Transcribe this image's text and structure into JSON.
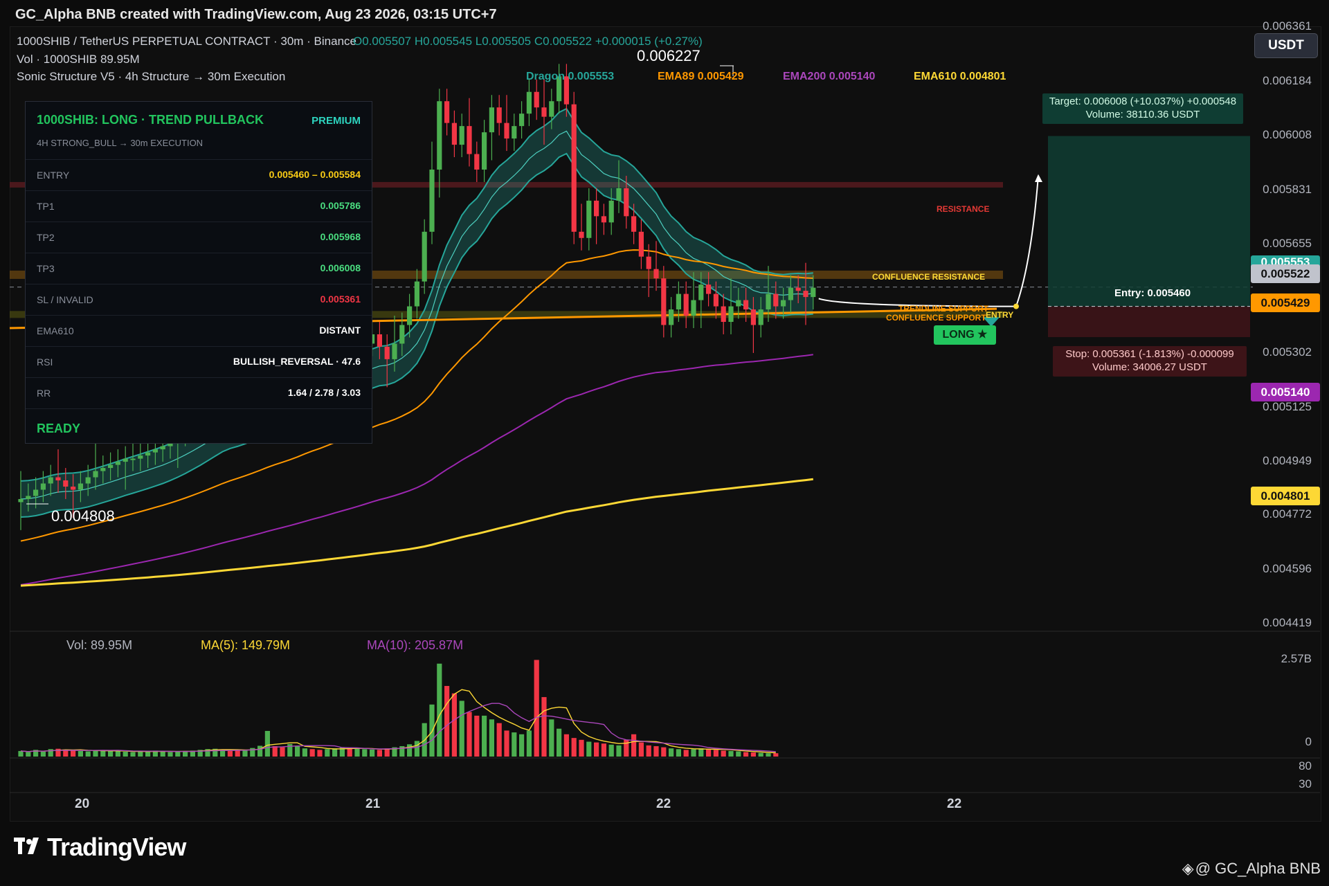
{
  "header": {
    "title": "GC_Alpha BNB created with TradingView.com, Aug 23 2026, 03:15 UTC+7"
  },
  "legend": {
    "symbol": "1000SHIB / TetherUS PERPETUAL CONTRACT · 30m · Binance",
    "ohlc": "O0.005507 H0.005545 L0.005505 C0.005522 +0.000015 (+0.27%)",
    "volume": "Vol · 1000SHIB  89.95M",
    "indicator": "Sonic Structure V5 · 4h Structure → 30m Execution"
  },
  "ema_labels": {
    "dragon": "Dragon 0.005553",
    "ema89": "EMA89 0.005429",
    "ema200": "EMA200 0.005140",
    "ema610": "EMA610 0.004801"
  },
  "colors": {
    "up": "#4caf50",
    "down": "#f23645",
    "dragon": "#26a69a",
    "ema89": "#ff9800",
    "ema200": "#9c27b0",
    "ema610": "#fdd835",
    "target_zone": "#0f3d33",
    "stop_zone": "#3d1418"
  },
  "signal_card": {
    "title": "1000SHIB: LONG · TREND PULLBACK",
    "badge": "PREMIUM",
    "subtitle": "4H STRONG_BULL → 30m EXECUTION",
    "rows": [
      {
        "key": "ENTRY",
        "value": "0.005460 – 0.005584"
      },
      {
        "key": "TP1",
        "value": "0.005786"
      },
      {
        "key": "TP2",
        "value": "0.005968"
      },
      {
        "key": "TP3",
        "value": "0.006008"
      },
      {
        "key": "SL / INVALID",
        "value": "0.005361"
      },
      {
        "key": "EMA610",
        "value": "DISTANT"
      },
      {
        "key": "RSI",
        "value": "BULLISH_REVERSAL · 47.6"
      },
      {
        "key": "RR",
        "value": "1.64 / 2.78 / 3.03"
      }
    ],
    "status": "READY"
  },
  "price_axis": {
    "ticks": [
      "0.006361",
      "0.006184",
      "0.006008",
      "0.005831",
      "0.005655",
      "0.005302",
      "0.005125",
      "0.004949",
      "0.004772",
      "0.004596",
      "0.004419"
    ],
    "currency_button": "USDT",
    "tags": {
      "dragon": "0.005553",
      "last": "0.005522",
      "ema89": "0.005429",
      "ema200": "0.005140",
      "ema610": "0.004801"
    }
  },
  "chart_annotations": {
    "high": "0.006227",
    "low": "0.004808",
    "resistance": "RESISTANCE",
    "confluence_resistance": "CONFLUENCE RESISTANCE",
    "trendline_support": "TRENDLINE SUPPORT",
    "confluence_support": "CONFLUENCE SUPPORT",
    "entry_marker": "ENTRY",
    "long_badge": "LONG ★",
    "entry": "Entry: 0.005460",
    "target_line1": "Target: 0.006008  (+10.037%)  +0.000548",
    "target_line2": "Volume: 38110.36 USDT",
    "stop_line1": "Stop: 0.005361  (-1.813%)  -0.000099",
    "stop_line2": "Volume: 34006.27 USDT"
  },
  "volume_pane": {
    "vol": "Vol: 89.95M",
    "ma5": "MA(5): 149.79M",
    "ma10": "MA(10): 205.87M",
    "axis_top": "2.57B",
    "axis_zero": "0"
  },
  "rsi_axis": {
    "top": "80",
    "bottom": "30"
  },
  "time_axis": [
    "20",
    "21",
    "22",
    "22"
  ],
  "footer": {
    "logo": "TradingView",
    "watermark": "@ GC_Alpha BNB"
  },
  "chart_data": {
    "type": "candlestick",
    "symbol": "1000SHIB/USDT",
    "timeframe": "30m",
    "y_range": [
      0.004419,
      0.006361
    ],
    "last_close": 0.005522,
    "high_marker": 0.006227,
    "low_marker": 0.004808,
    "indicators": [
      {
        "name": "Dragon",
        "last": 0.005553
      },
      {
        "name": "EMA89",
        "last": 0.005429
      },
      {
        "name": "EMA200",
        "last": 0.00514
      },
      {
        "name": "EMA610",
        "last": 0.004801
      }
    ],
    "closes": [
      0.00484,
      0.00485,
      0.00487,
      0.00489,
      0.00491,
      0.0049,
      0.00488,
      0.00487,
      0.00489,
      0.00491,
      0.00493,
      0.00494,
      0.00495,
      0.00496,
      0.00497,
      0.00497,
      0.00498,
      0.00499,
      0.005,
      0.00501,
      0.00503,
      0.00505,
      0.00507,
      0.00509,
      0.00511,
      0.00513,
      0.00515,
      0.00516,
      0.00514,
      0.00512,
      0.00514,
      0.00516,
      0.00518,
      0.00521,
      0.00519,
      0.00517,
      0.00519,
      0.00522,
      0.00526,
      0.00525,
      0.00523,
      0.00527,
      0.00529,
      0.0053,
      0.00527,
      0.00532,
      0.00534,
      0.00537,
      0.00533,
      0.00529,
      0.00534,
      0.0054,
      0.00546,
      0.00554,
      0.0057,
      0.0059,
      0.00612,
      0.00605,
      0.00598,
      0.00604,
      0.00595,
      0.0059,
      0.00602,
      0.0061,
      0.00605,
      0.006,
      0.00604,
      0.00608,
      0.00615,
      0.0061,
      0.00607,
      0.00612,
      0.0062,
      0.00611,
      0.0057,
      0.00568,
      0.0058,
      0.00575,
      0.00573,
      0.0058,
      0.00584,
      0.00575,
      0.0057,
      0.00562,
      0.00558,
      0.00555,
      0.0054,
      0.00545,
      0.0055,
      0.00543,
      0.00548,
      0.00553,
      0.0055,
      0.00546,
      0.00541,
      0.00546,
      0.00548,
      0.00545,
      0.0054,
      0.00545,
      0.0055,
      0.00546,
      0.00548,
      0.00552,
      0.00551,
      0.00549,
      0.00552
    ],
    "opens": [
      0.00483,
      0.00484,
      0.00485,
      0.00487,
      0.00489,
      0.00491,
      0.0049,
      0.00488,
      0.00487,
      0.00489,
      0.00491,
      0.00493,
      0.00494,
      0.00495,
      0.00496,
      0.00497,
      0.00497,
      0.00498,
      0.00499,
      0.005,
      0.00501,
      0.00503,
      0.00505,
      0.00507,
      0.00509,
      0.00511,
      0.00513,
      0.00515,
      0.00516,
      0.00514,
      0.00512,
      0.00514,
      0.00516,
      0.00518,
      0.00521,
      0.00519,
      0.00517,
      0.00519,
      0.00522,
      0.00526,
      0.00525,
      0.00523,
      0.00527,
      0.00529,
      0.0053,
      0.00527,
      0.00532,
      0.00534,
      0.00537,
      0.00533,
      0.00529,
      0.00534,
      0.0054,
      0.00546,
      0.00554,
      0.0057,
      0.0059,
      0.00612,
      0.00605,
      0.00598,
      0.00604,
      0.00595,
      0.0059,
      0.00602,
      0.0061,
      0.00605,
      0.006,
      0.00604,
      0.00608,
      0.00615,
      0.0061,
      0.00607,
      0.00612,
      0.0062,
      0.00611,
      0.0057,
      0.00568,
      0.0058,
      0.00575,
      0.00573,
      0.0058,
      0.00584,
      0.00575,
      0.0057,
      0.00562,
      0.00558,
      0.00555,
      0.0054,
      0.00545,
      0.0055,
      0.00543,
      0.00548,
      0.00553,
      0.0055,
      0.00546,
      0.00541,
      0.00546,
      0.00548,
      0.00545,
      0.0054,
      0.00545,
      0.0055,
      0.00546,
      0.00548,
      0.00552,
      0.00551,
      0.00549
    ],
    "volumes_M": [
      150,
      120,
      180,
      130,
      200,
      210,
      190,
      160,
      150,
      140,
      170,
      160,
      150,
      140,
      130,
      120,
      150,
      140,
      160,
      130,
      120,
      140,
      150,
      160,
      180,
      200,
      210,
      190,
      150,
      170,
      160,
      230,
      290,
      690,
      280,
      250,
      340,
      290,
      220,
      200,
      180,
      200,
      220,
      240,
      230,
      210,
      200,
      190,
      180,
      220,
      250,
      280,
      330,
      420,
      900,
      1400,
      2500,
      1900,
      1700,
      1500,
      1200,
      1100,
      1100,
      1000,
      900,
      700,
      650,
      600,
      700,
      2600,
      1600,
      1000,
      750,
      600,
      500,
      450,
      400,
      380,
      350,
      320,
      300,
      450,
      600,
      380,
      300,
      280,
      250,
      220,
      200,
      180,
      200,
      220,
      200,
      180,
      160,
      150,
      140,
      120,
      110,
      100,
      90,
      90
    ]
  }
}
